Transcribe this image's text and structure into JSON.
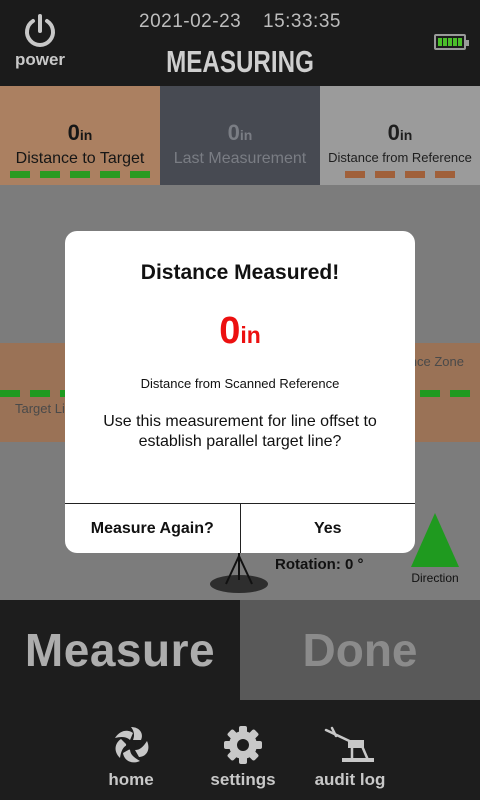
{
  "header": {
    "power_label": "power",
    "date": "2021-02-23",
    "time": "15:33:35",
    "title": "MEASURING",
    "battery_level": 1.0
  },
  "metrics": [
    {
      "value": "0",
      "unit": "in",
      "label": "Distance to Target",
      "color": "#ab8061",
      "dash_color": "#2a9a21"
    },
    {
      "value": "0",
      "unit": "in",
      "label": "Last Measurement",
      "color": "#474a52"
    },
    {
      "value": "0",
      "unit": "in",
      "label": "Distance from Reference",
      "color": "#9b9b9b",
      "dash_color": "#a0603a"
    }
  ],
  "field": {
    "target_line_label": "Target Li",
    "reference_zone_label": "nce Zone",
    "rotation_text": "Rotation: 0 °",
    "direction_label": "Direction"
  },
  "dialog": {
    "title": "Distance Measured!",
    "value": "0",
    "unit": "in",
    "caption": "Distance from Scanned Reference",
    "question": "Use this measurement for line offset to establish parallel target line?",
    "secondary_button": "Measure Again?",
    "primary_button": "Yes"
  },
  "actions": {
    "measure_label": "Measure",
    "done_label": "Done"
  },
  "nav": {
    "items": [
      {
        "label": "home",
        "icon": "aperture-icon"
      },
      {
        "label": "settings",
        "icon": "gear-icon"
      },
      {
        "label": "audit log",
        "icon": "crane-icon"
      }
    ]
  },
  "colors": {
    "accent_green": "#2a9a21",
    "value_red": "#ec1010"
  }
}
